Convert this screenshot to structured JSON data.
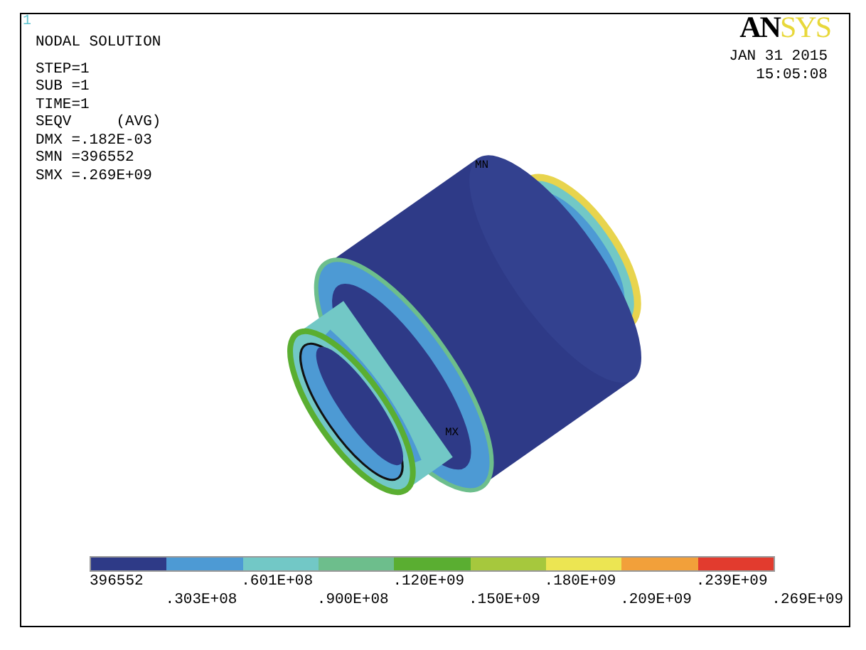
{
  "window_number": "1",
  "info": {
    "title": "NODAL SOLUTION",
    "lines": [
      "STEP=1",
      "SUB =1",
      "TIME=1",
      "SEQV     (AVG)",
      "DMX =.182E-03",
      "SMN =396552",
      "SMX =.269E+09"
    ]
  },
  "logo": {
    "text_1": "AN",
    "text_2": "SYS"
  },
  "date": "JAN 31 2015",
  "time": "15:05:08",
  "model_labels": [
    {
      "kind": "min",
      "text": "MN"
    },
    {
      "kind": "max",
      "text": "MX"
    }
  ],
  "legend": {
    "bands": [
      {
        "color": "#2e3a87"
      },
      {
        "color": "#4d9ad4"
      },
      {
        "color": "#72c8c6"
      },
      {
        "color": "#6dbe8c"
      },
      {
        "color": "#5aae31"
      },
      {
        "color": "#a6c83d"
      },
      {
        "color": "#ece552"
      },
      {
        "color": "#f2a03a"
      },
      {
        "color": "#e23b2e"
      }
    ],
    "labels": [
      "396552",
      ".303E+08",
      ".601E+08",
      ".900E+08",
      ".120E+09",
      ".150E+09",
      ".180E+09",
      ".209E+09",
      ".239E+09",
      ".269E+09"
    ]
  }
}
